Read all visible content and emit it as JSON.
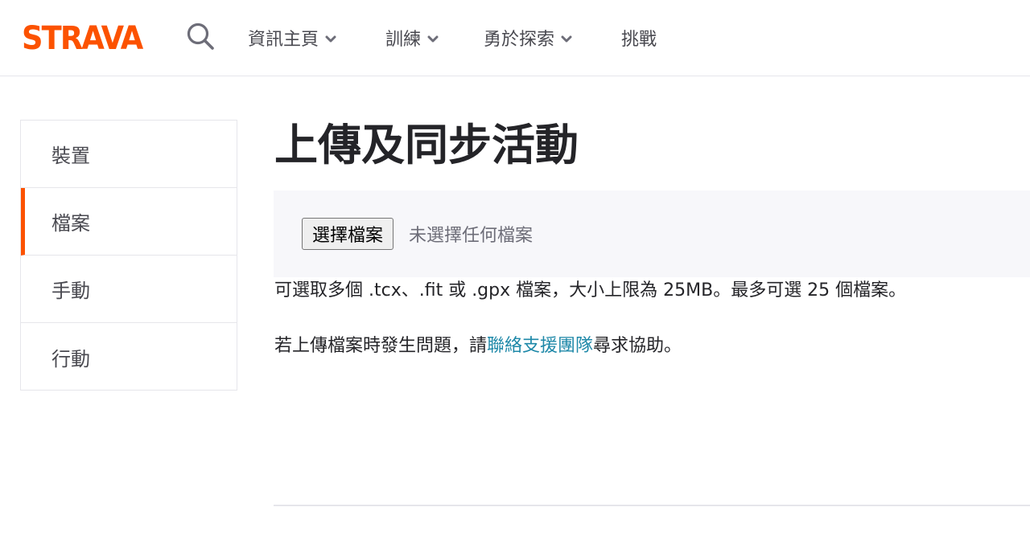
{
  "header": {
    "logo_text": "STRAVA",
    "nav": [
      {
        "label": "資訊主頁",
        "has_dropdown": true
      },
      {
        "label": "訓練",
        "has_dropdown": true
      },
      {
        "label": "勇於探索",
        "has_dropdown": true
      },
      {
        "label": "挑戰",
        "has_dropdown": false
      }
    ]
  },
  "sidebar": {
    "items": [
      {
        "label": "裝置",
        "active": false
      },
      {
        "label": "檔案",
        "active": true
      },
      {
        "label": "手動",
        "active": false
      },
      {
        "label": "行動",
        "active": false
      }
    ]
  },
  "main": {
    "title": "上傳及同步活動",
    "upload": {
      "button_label": "選擇檔案",
      "status_text": "未選擇任何檔案"
    },
    "file_info": "可選取多個 .tcx、.fit 或 .gpx 檔案，大小上限為 25MB。最多可選 25 個檔案。",
    "help": {
      "prefix": "若上傳檔案時發生問題，請",
      "link_text": "聯絡支援團隊",
      "suffix": "尋求協助。"
    }
  },
  "colors": {
    "brand": "#fc5200",
    "link": "#1e88a8",
    "panel_bg": "#f7f7fa"
  }
}
